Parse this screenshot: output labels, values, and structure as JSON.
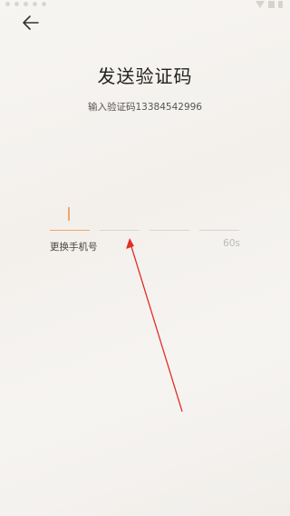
{
  "header": {
    "back_icon": "arrow-left-icon"
  },
  "page": {
    "title": "发送验证码",
    "subtitle": "输入验证码13384542996"
  },
  "code_input": {
    "length": 4,
    "active_index": 0,
    "accent_color": "#f0a56e",
    "inactive_color": "#d8d5d1"
  },
  "actions": {
    "change_phone": "更换手机号",
    "countdown": "60s"
  },
  "annotation": {
    "type": "arrow",
    "color": "#e0302a"
  }
}
